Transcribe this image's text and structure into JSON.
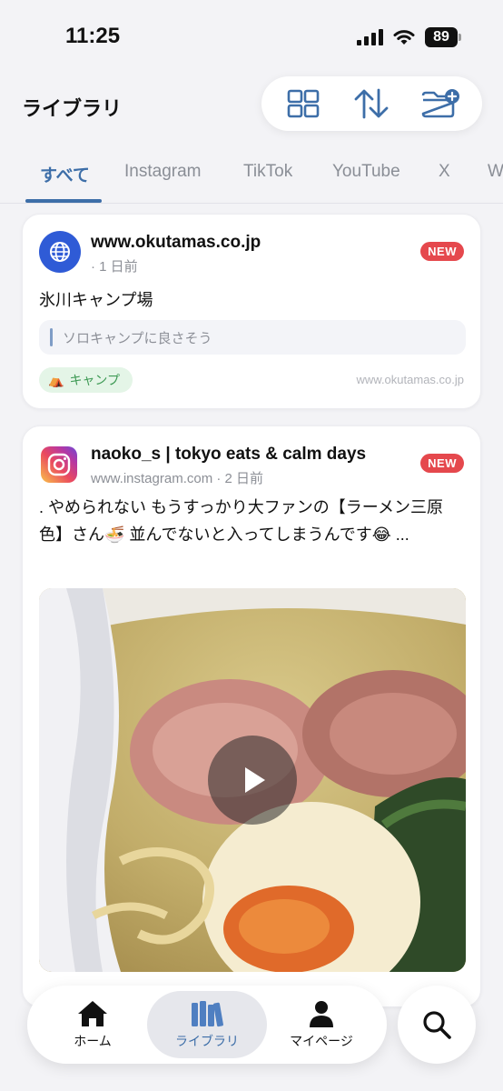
{
  "status_bar": {
    "time": "11:25",
    "battery": "89"
  },
  "header": {
    "title": "ライブラリ",
    "toolbar": [
      {
        "icon": "grid-view-icon"
      },
      {
        "icon": "sort-icon"
      },
      {
        "icon": "new-folder-icon"
      }
    ]
  },
  "tabs": [
    "すべて",
    "Instagram",
    "TikTok",
    "YouTube",
    "X",
    "W"
  ],
  "active_tab": "すべて",
  "cards": [
    {
      "site": "www.okutamas.co.jp",
      "meta": "· 1 日前",
      "badge": "NEW",
      "title": "氷川キャンプ場",
      "memo": "ソロキャンプに良さそう",
      "tag_emoji": "⛺",
      "tag": "キャンプ",
      "source": "www.okutamas.co.jp",
      "icon": "globe-icon"
    },
    {
      "author": "naoko_s | tokyo eats & calm days",
      "meta": "www.instagram.com · 2 日前",
      "badge": "NEW",
      "body": ". やめられない もうすっかり大ファンの【ラーメン三原色】さん🍜 並んでないと入ってしまうんです😂 ...",
      "icon": "instagram-icon",
      "media": "ramen-video-thumbnail"
    }
  ],
  "bottom_nav": [
    {
      "label": "ホーム",
      "icon": "home-icon"
    },
    {
      "label": "ライブラリ",
      "icon": "library-icon",
      "active": true
    },
    {
      "label": "マイページ",
      "icon": "person-icon"
    }
  ],
  "colors": {
    "accent": "#3d6ea8",
    "new_badge": "#e5484d",
    "tag_bg": "#e4f5e7",
    "tag_text": "#3e9a55",
    "globe": "#2f5bd6"
  }
}
